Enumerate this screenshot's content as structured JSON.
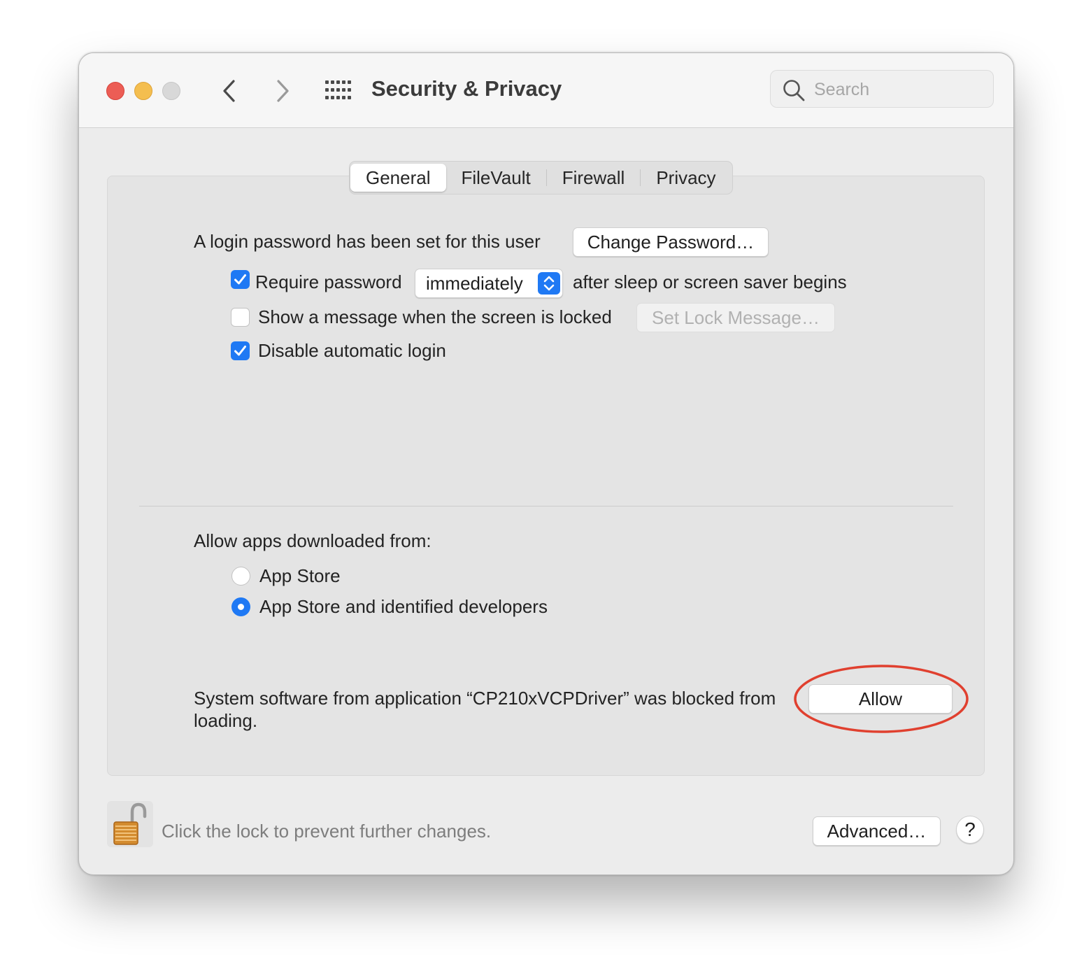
{
  "window": {
    "title": "Security & Privacy",
    "search_placeholder": "Search"
  },
  "tabs": [
    {
      "label": "General",
      "active": true
    },
    {
      "label": "FileVault",
      "active": false
    },
    {
      "label": "Firewall",
      "active": false
    },
    {
      "label": "Privacy",
      "active": false
    }
  ],
  "general": {
    "login_password_text": "A login password has been set for this user",
    "change_password_label": "Change Password…",
    "require_password": {
      "checked": true,
      "label": "Require password",
      "selected_option": "immediately",
      "suffix": "after sleep or screen saver begins"
    },
    "show_message": {
      "checked": false,
      "label": "Show a message when the screen is locked",
      "button_label": "Set Lock Message…"
    },
    "disable_auto_login": {
      "checked": true,
      "label": "Disable automatic login"
    }
  },
  "allow_apps": {
    "heading": "Allow apps downloaded from:",
    "options": [
      {
        "label": "App Store",
        "selected": false
      },
      {
        "label": "App Store and identified developers",
        "selected": true
      }
    ]
  },
  "blocked": {
    "message": "System software from application “CP210xVCPDriver” was blocked from loading.",
    "allow_label": "Allow",
    "highlight_color": "#e0402f"
  },
  "footer": {
    "lock_text": "Click the lock to prevent further changes.",
    "advanced_label": "Advanced…",
    "help_label": "?"
  },
  "colors": {
    "accent": "#1f79f4",
    "close": "#ec5d55",
    "minimize": "#f4be4f",
    "zoom_inactive": "#d8d8d8"
  }
}
